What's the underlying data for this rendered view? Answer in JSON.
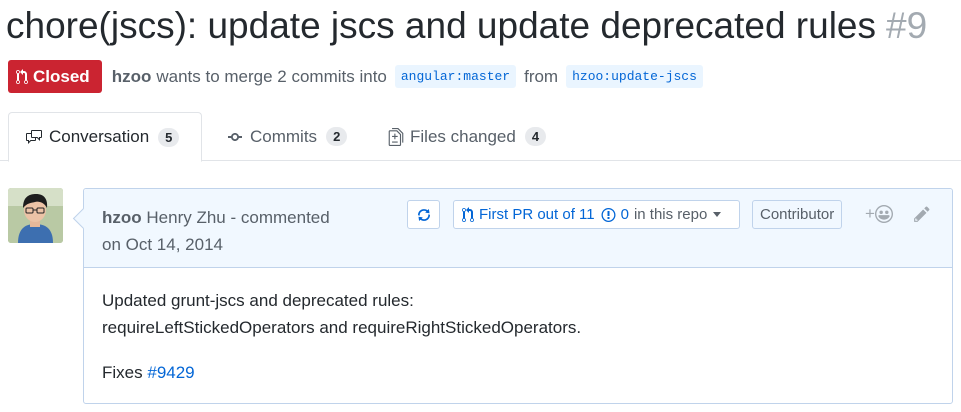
{
  "pr": {
    "title": "chore(jscs): update jscs and update deprecated rules",
    "number": "#9"
  },
  "meta": {
    "state_label": "Closed",
    "author": "hzoo",
    "merge_text": "wants to merge 2 commits into",
    "base_branch": "angular:master",
    "from_word": "from",
    "head_branch": "hzoo:update-jscs"
  },
  "tabs": [
    {
      "label": "Conversation",
      "count": "5"
    },
    {
      "label": "Commits",
      "count": "2"
    },
    {
      "label": "Files changed",
      "count": "4"
    }
  ],
  "comment": {
    "author": "hzoo",
    "author_name": "Henry Zhu",
    "action": "- commented",
    "date": "on Oct 14, 2014",
    "first_pr": "First PR out of 11",
    "issue_count": "0",
    "in_repo": "in this repo",
    "role_badge": "Contributor",
    "body_line1": "Updated grunt-jscs and deprecated rules:",
    "body_line2": "requireLeftStickedOperators and requireRightStickedOperators.",
    "fixes_label": "Fixes",
    "fixes_link": "#9429"
  },
  "icons": {
    "state": "git-pull-request-icon",
    "conversation": "comment-discussion-icon",
    "commits": "git-commit-icon",
    "files": "file-diff-icon",
    "sync": "sync-icon",
    "pr": "git-pull-request-icon",
    "issue": "issue-opened-icon",
    "reaction": "smiley-icon",
    "edit": "pencil-icon"
  },
  "colors": {
    "closed_red": "#cb2431",
    "link_blue": "#0366d6",
    "header_blue": "#f1f8ff",
    "border_blue": "#c0d3eb"
  }
}
